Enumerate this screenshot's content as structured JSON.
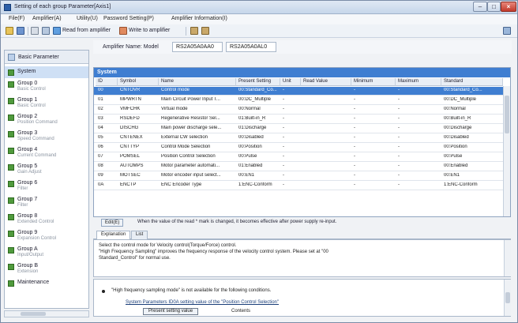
{
  "window": {
    "title": "Setting of each group Parameter[Axis1]"
  },
  "menu": [
    "File(F)",
    "Amplifier(A)",
    "Utility(U)",
    "Password Setting(P)",
    "Amplifier Information(I)"
  ],
  "toolbar": {
    "read_label": "Read from amplifier",
    "write_label": "Write to amplifier"
  },
  "sidebar": {
    "header": "Basic Parameter",
    "items": [
      {
        "name": "System",
        "sub": ""
      },
      {
        "name": "Group 0",
        "sub": "Basic Control"
      },
      {
        "name": "Group 1",
        "sub": "Basic Control"
      },
      {
        "name": "Group 2",
        "sub": "Position Command"
      },
      {
        "name": "Group 3",
        "sub": "Speed Command"
      },
      {
        "name": "Group 4",
        "sub": "Current Command"
      },
      {
        "name": "Group 5",
        "sub": "Gain Adjust"
      },
      {
        "name": "Group 6",
        "sub": "Filter"
      },
      {
        "name": "Group 7",
        "sub": "Filter"
      },
      {
        "name": "Group 8",
        "sub": "Extended Control"
      },
      {
        "name": "Group 9",
        "sub": "Expansion Control"
      },
      {
        "name": "Group A",
        "sub": "Input/Output"
      },
      {
        "name": "Group B",
        "sub": "Extension"
      },
      {
        "name": "Maintenance",
        "sub": ""
      }
    ]
  },
  "amplifier": {
    "label": "Amplifier Name: Model",
    "model1": "RS2A05A0AA0",
    "model2": "RS2A05A0AL0"
  },
  "table": {
    "title": "System",
    "columns": [
      "ID",
      "Symbol",
      "Name",
      "Present Setting",
      "Unit",
      "Read Value",
      "Minimum",
      "Maximum",
      "Standard"
    ],
    "rows": [
      [
        "00",
        "CNTOVR",
        "Control mode",
        "00:Standard_Co...",
        "-",
        "",
        "-",
        "-",
        "00:Standard_Co..."
      ],
      [
        "01",
        "MPWRTN",
        "Main Circuit Power Input T...",
        "00:DC_Multiple",
        "-",
        "",
        "-",
        "-",
        "00:DC_Multiple"
      ],
      [
        "02",
        "VMFCHK",
        "Virtual mode",
        "00:Normal",
        "-",
        "",
        "-",
        "-",
        "00:Normal"
      ],
      [
        "03",
        "RSDEFD",
        "Regenerative Resistor Sel...",
        "01:Built-in_R",
        "-",
        "",
        "-",
        "-",
        "00:Built-in_R"
      ],
      [
        "04",
        "DISCHG",
        "Main power discharge sele...",
        "01:Discharge",
        "-",
        "",
        "-",
        "-",
        "00:Discharge"
      ],
      [
        "05",
        "CNTENEX",
        "External CW selection",
        "00:Disabled",
        "-",
        "",
        "-",
        "-",
        "00:Disabled"
      ],
      [
        "06",
        "CNTTYP",
        "Control Mode Selection",
        "00:Position",
        "-",
        "",
        "-",
        "-",
        "00:Position"
      ],
      [
        "07",
        "POMSEL",
        "Position Control Selection",
        "00:Pulse",
        "-",
        "",
        "-",
        "-",
        "00:Pulse"
      ],
      [
        "08",
        "AUTOMPS",
        "Motor parameter automati...",
        "01:Enabled",
        "-",
        "",
        "-",
        "-",
        "00:Enabled"
      ],
      [
        "09",
        "MOTSEC",
        "Motor encoder input select...",
        "00:EN1",
        "-",
        "",
        "-",
        "-",
        "00:EN1"
      ],
      [
        "0A",
        "ENCTP",
        "ENC Encoder Type",
        "1:ENC-Conform",
        "-",
        "",
        "-",
        "-",
        "1:ENC-Conform"
      ]
    ]
  },
  "status": {
    "button": "Edit(E)",
    "text": "When the value of the read * mark is changed, it becomes effective after power supply re-input."
  },
  "tabs": [
    "Explanation",
    "List"
  ],
  "description": {
    "lines": [
      "Select the control mode for Velocity control(Torque/Force) control.",
      "\"High Frequency Sampling\" improves the frequency response of the velocity control system. Please set at \"00",
      "Standard_Control\" for normal use."
    ]
  },
  "notes": {
    "line1": "\"High frequency sampling mode\" is not available for the following conditions.",
    "line2": "System Parameters ID0A setting value of the \"Position Control Selection\"",
    "button": "Present setting value",
    "line3": "Contents"
  },
  "colors": {
    "accent": "#3f7ed1",
    "sidebar_bullet": "#4f9a3c"
  }
}
